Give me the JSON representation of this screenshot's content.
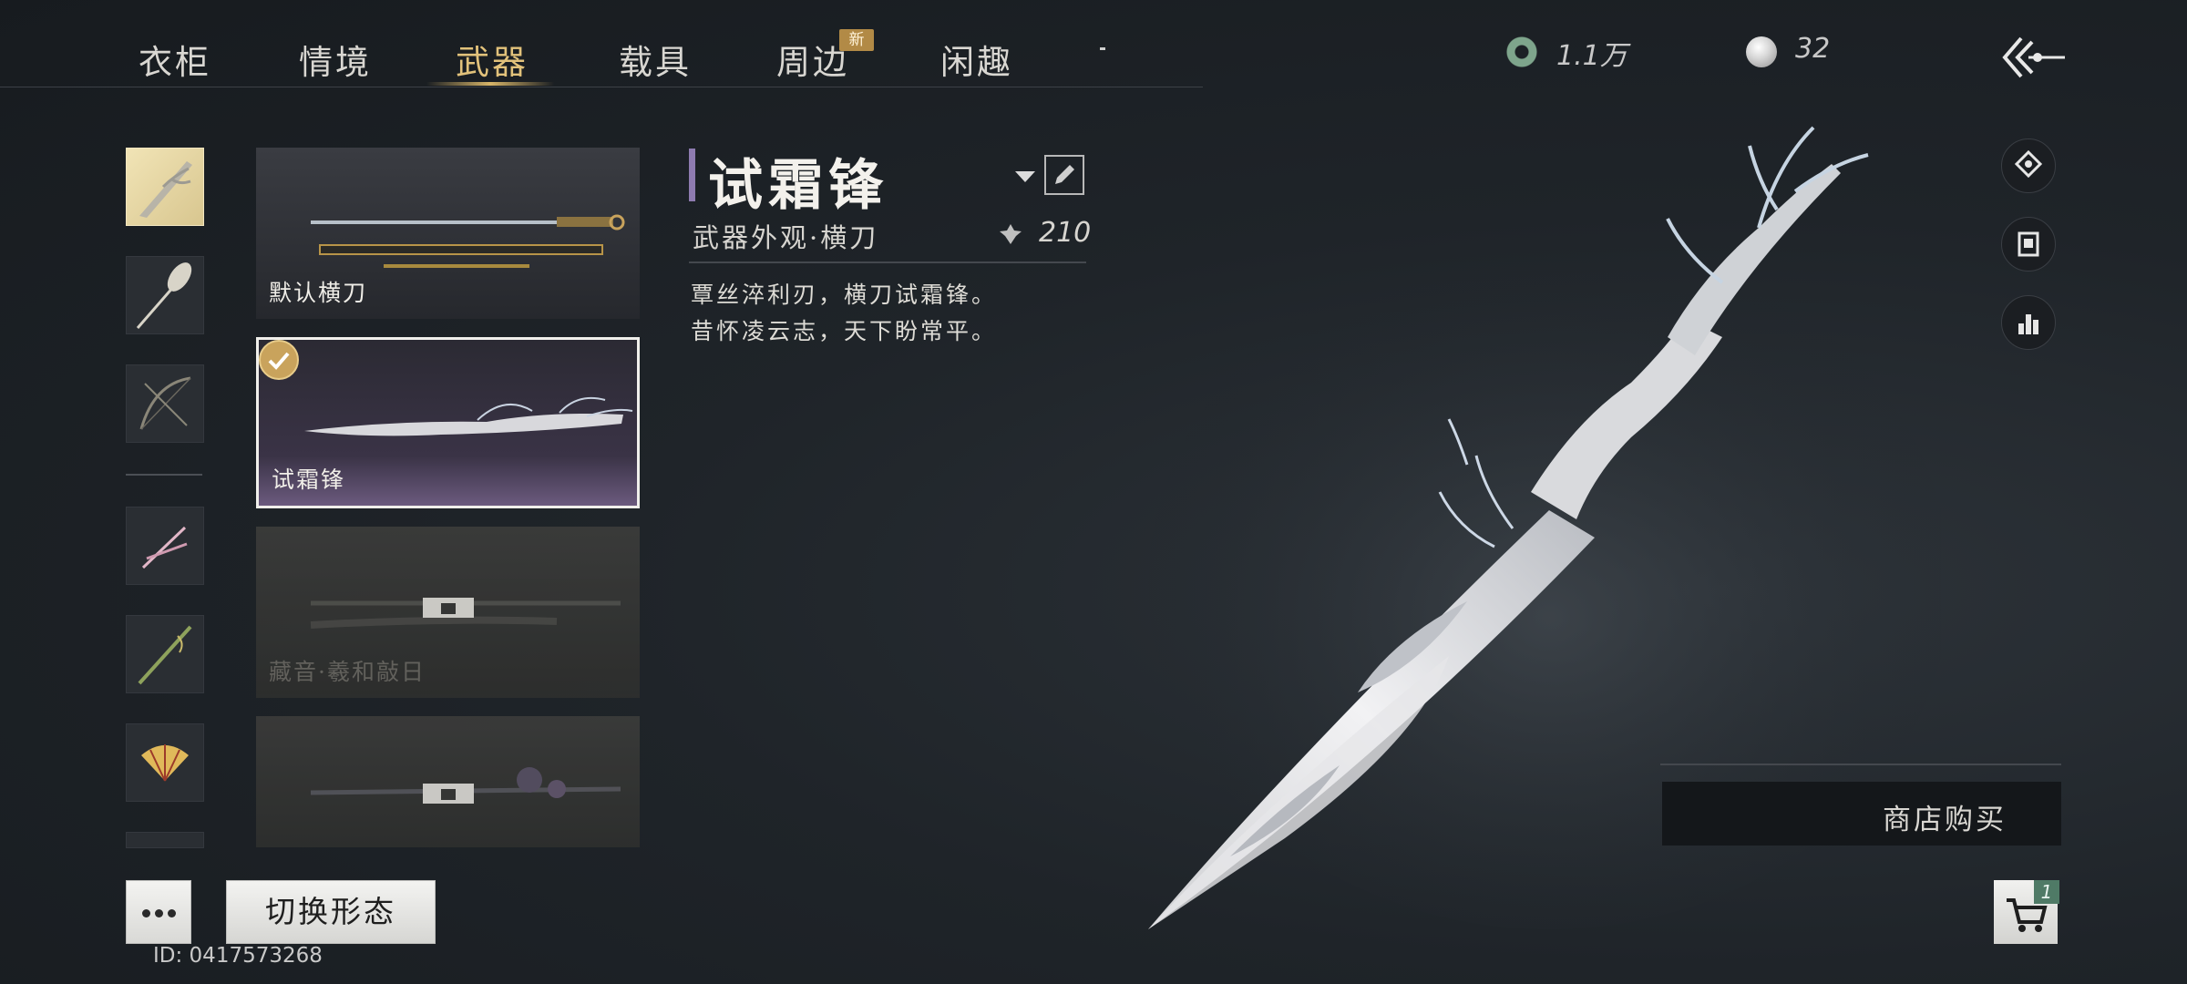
{
  "tabs": [
    {
      "label": "衣柜"
    },
    {
      "label": "情境"
    },
    {
      "label": "武器",
      "active": true
    },
    {
      "label": "载具"
    },
    {
      "label": "周边",
      "badge": "新"
    },
    {
      "label": "闲趣"
    }
  ],
  "currency": {
    "jade": {
      "icon": "jade-coin-icon",
      "value": "1.1万"
    },
    "pearl": {
      "icon": "pearl-icon",
      "value": "32"
    }
  },
  "categories": [
    {
      "icon": "blade-category-icon",
      "selected": true
    },
    {
      "icon": "umbrella-category-icon"
    },
    {
      "icon": "bow-category-icon"
    },
    {
      "icon": "dual-blades-icon"
    },
    {
      "icon": "spear-icon"
    },
    {
      "icon": "fan-icon"
    },
    {
      "icon": "more-category-icon"
    }
  ],
  "weapons": [
    {
      "name": "默认横刀",
      "state": "owned"
    },
    {
      "name": "试霜锋",
      "state": "equipped"
    },
    {
      "name": "藏音·羲和敲日",
      "state": "locked"
    },
    {
      "name": "",
      "state": "locked"
    }
  ],
  "detail": {
    "title": "试霜锋",
    "subtitle": "武器外观·横刀",
    "score": "210",
    "desc_line1": "覃丝淬利刃，横刀试霜锋。",
    "desc_line2": "昔怀凌云志，天下盼常平。"
  },
  "right_icons": [
    "appearance-icon",
    "wardrobe-icon",
    "ranking-icon"
  ],
  "shop": {
    "label": "商店购买"
  },
  "bottom": {
    "switch_label": "切换形态",
    "uid": "ID: 0417573268",
    "cart_count": "1"
  },
  "colors": {
    "accent_gold": "#e2c27b",
    "title_bar": "#8e7bb0",
    "cart_badge": "#4f7a66"
  }
}
